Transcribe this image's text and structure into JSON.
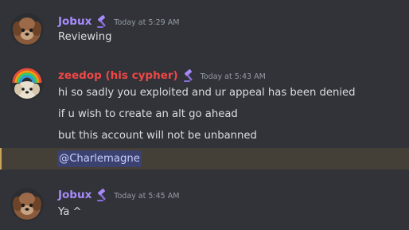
{
  "colors": {
    "background": "#313338",
    "jobux_name": "#a78bfa",
    "zeedop_name": "#f04747",
    "text": "#dbdee1",
    "timestamp": "#949ba4",
    "mention_bg": "#3c4270",
    "highlight_bg": "#444037"
  },
  "messages": [
    {
      "username": "Jobux",
      "avatar": "dog-avatar-icon",
      "role_icon": "gavel-icon",
      "timestamp": "Today at 5:29 AM",
      "lines": [
        "Reviewing"
      ]
    },
    {
      "username": "zeedop (his cypher)",
      "avatar": "rainbow-dog-avatar-icon",
      "role_icon": "gavel-icon",
      "timestamp": "Today at 5:43 AM",
      "lines": [
        "hi so sadly you exploited and ur appeal has been denied",
        "if u wish to create an alt go ahead",
        "but this account will not be unbanned"
      ],
      "mention": "@Charlemagne"
    },
    {
      "username": "Jobux",
      "avatar": "dog-avatar-icon",
      "role_icon": "gavel-icon",
      "timestamp": "Today at 5:45 AM",
      "lines": [
        "Ya ^"
      ]
    }
  ]
}
